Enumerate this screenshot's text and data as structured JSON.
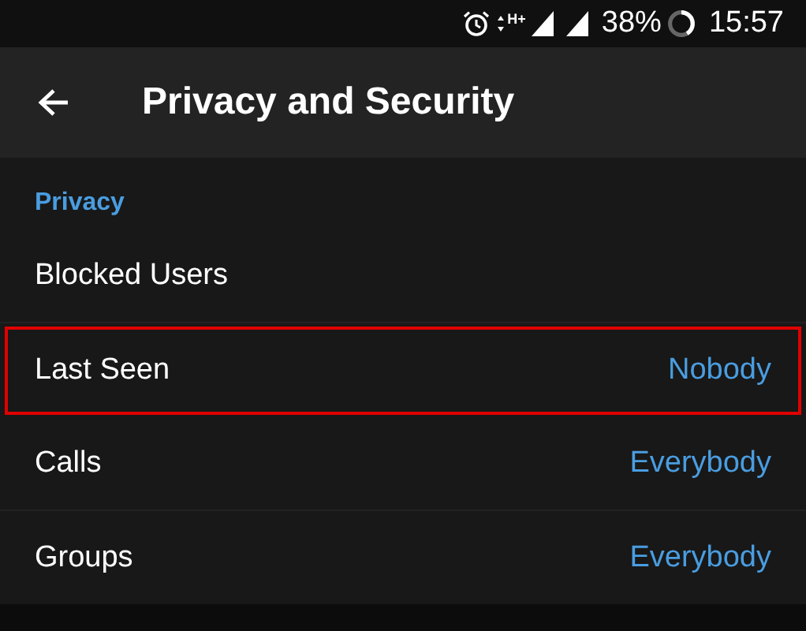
{
  "status_bar": {
    "network_type": "H+",
    "battery": "38%",
    "time": "15:57"
  },
  "app_bar": {
    "title": "Privacy and Security"
  },
  "section": {
    "header": "Privacy",
    "rows": [
      {
        "label": "Blocked Users",
        "highlighted": false
      },
      {
        "label": "Last Seen",
        "value": "Nobody",
        "highlighted": true
      },
      {
        "label": "Calls",
        "value": "Everybody",
        "highlighted": false
      },
      {
        "label": "Groups",
        "value": "Everybody",
        "highlighted": false
      }
    ]
  }
}
